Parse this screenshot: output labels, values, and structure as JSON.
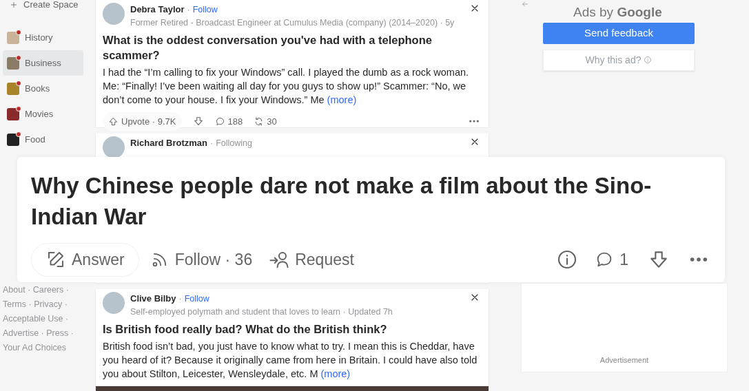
{
  "separator": "·",
  "sidebar": {
    "create_label": "Create Space",
    "items": [
      {
        "label": "History",
        "selected": false,
        "has_update": true,
        "color": "#c9b49a"
      },
      {
        "label": "Business",
        "selected": true,
        "has_update": true,
        "color": "#8a7a66"
      },
      {
        "label": "Books",
        "selected": false,
        "has_update": true,
        "color": "#a8832a"
      },
      {
        "label": "Movies",
        "selected": false,
        "has_update": true,
        "color": "#8b2a2a"
      },
      {
        "label": "Food",
        "selected": false,
        "has_update": true,
        "color": "#222222"
      }
    ],
    "footer_lines": [
      [
        "About",
        "Careers"
      ],
      [
        "Terms",
        "Privacy"
      ],
      [
        "Acceptable Use"
      ],
      [
        "Advertise",
        "Press"
      ],
      [
        "Your Ad Choices"
      ]
    ]
  },
  "feed": [
    {
      "author": "Debra Taylor",
      "follow": "Follow",
      "following": false,
      "credential": "Former Retired - Broadcast Engineer at Cumulus Media (company) (2014–2020) · 5y",
      "question": "What is the oddest conversation you've had with a telephone scammer?",
      "body": "I had the “I’m calling to fix your Windows” call. I played the dumb as a rock woman. Me: “Finally! I’ve been waiting all day for you guys to show up!” Scammer: “No, we don’t come to your house. I fix your Windows.” Me",
      "more": "(more)",
      "upvote": "Upvote · 9.7K",
      "comments": "188",
      "shares": "30"
    },
    {
      "author": "Richard Brotzman",
      "follow": "Following",
      "following": true
    },
    {
      "author": "Clive Bilby",
      "follow": "Follow",
      "following": false,
      "credential": "Self-employed polymath and student that loves to learn · Updated 7h",
      "question": "Is British food really bad? What do the British think?",
      "body": "British food isn’t bad, you just have to know what to try. I mean this is Cheddar, have you heard of it? Because it originally came from here in Britain. I could have also told you about Stilton, Leicester, Wensleydale, etc. M",
      "more": "(more)",
      "photo": true
    }
  ],
  "ads": {
    "title_prefix": "Ads by",
    "brand": "Google",
    "send_feedback": "Send feedback",
    "why": "Why this ad?",
    "advertisement": "Advertisement"
  },
  "question_card": {
    "title": "Why Chinese people dare not make a film about the Sino-Indian War",
    "answer": "Answer",
    "follow": "Follow",
    "follow_count": "36",
    "request": "Request",
    "comments": "1"
  }
}
